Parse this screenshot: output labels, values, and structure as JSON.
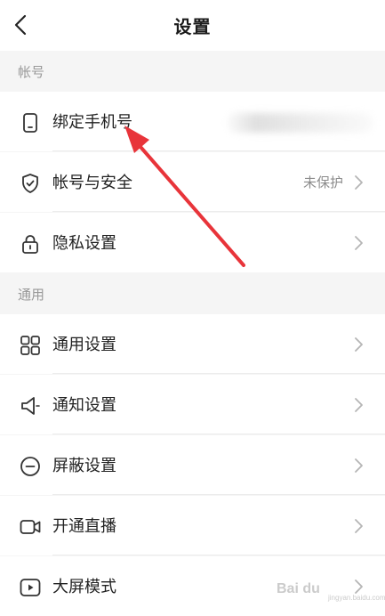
{
  "header": {
    "title": "设置"
  },
  "sections": [
    {
      "title": "帐号",
      "items": [
        {
          "label": "绑定手机号",
          "icon": "phone-icon"
        },
        {
          "label": "帐号与安全",
          "icon": "shield-check-icon",
          "value": "未保护"
        },
        {
          "label": "隐私设置",
          "icon": "lock-icon"
        }
      ]
    },
    {
      "title": "通用",
      "items": [
        {
          "label": "通用设置",
          "icon": "grid-icon"
        },
        {
          "label": "通知设置",
          "icon": "speaker-icon"
        },
        {
          "label": "屏蔽设置",
          "icon": "block-icon"
        },
        {
          "label": "开通直播",
          "icon": "video-camera-icon"
        },
        {
          "label": "大屏模式",
          "icon": "play-screen-icon"
        }
      ]
    }
  ],
  "watermark": {
    "text": "Bai du",
    "sub": "jingyan.baidu.com"
  },
  "colors": {
    "annotation_arrow": "#e8343a",
    "divider": "#ececec",
    "section_bg": "#f5f5f5",
    "muted_text": "#999999"
  }
}
